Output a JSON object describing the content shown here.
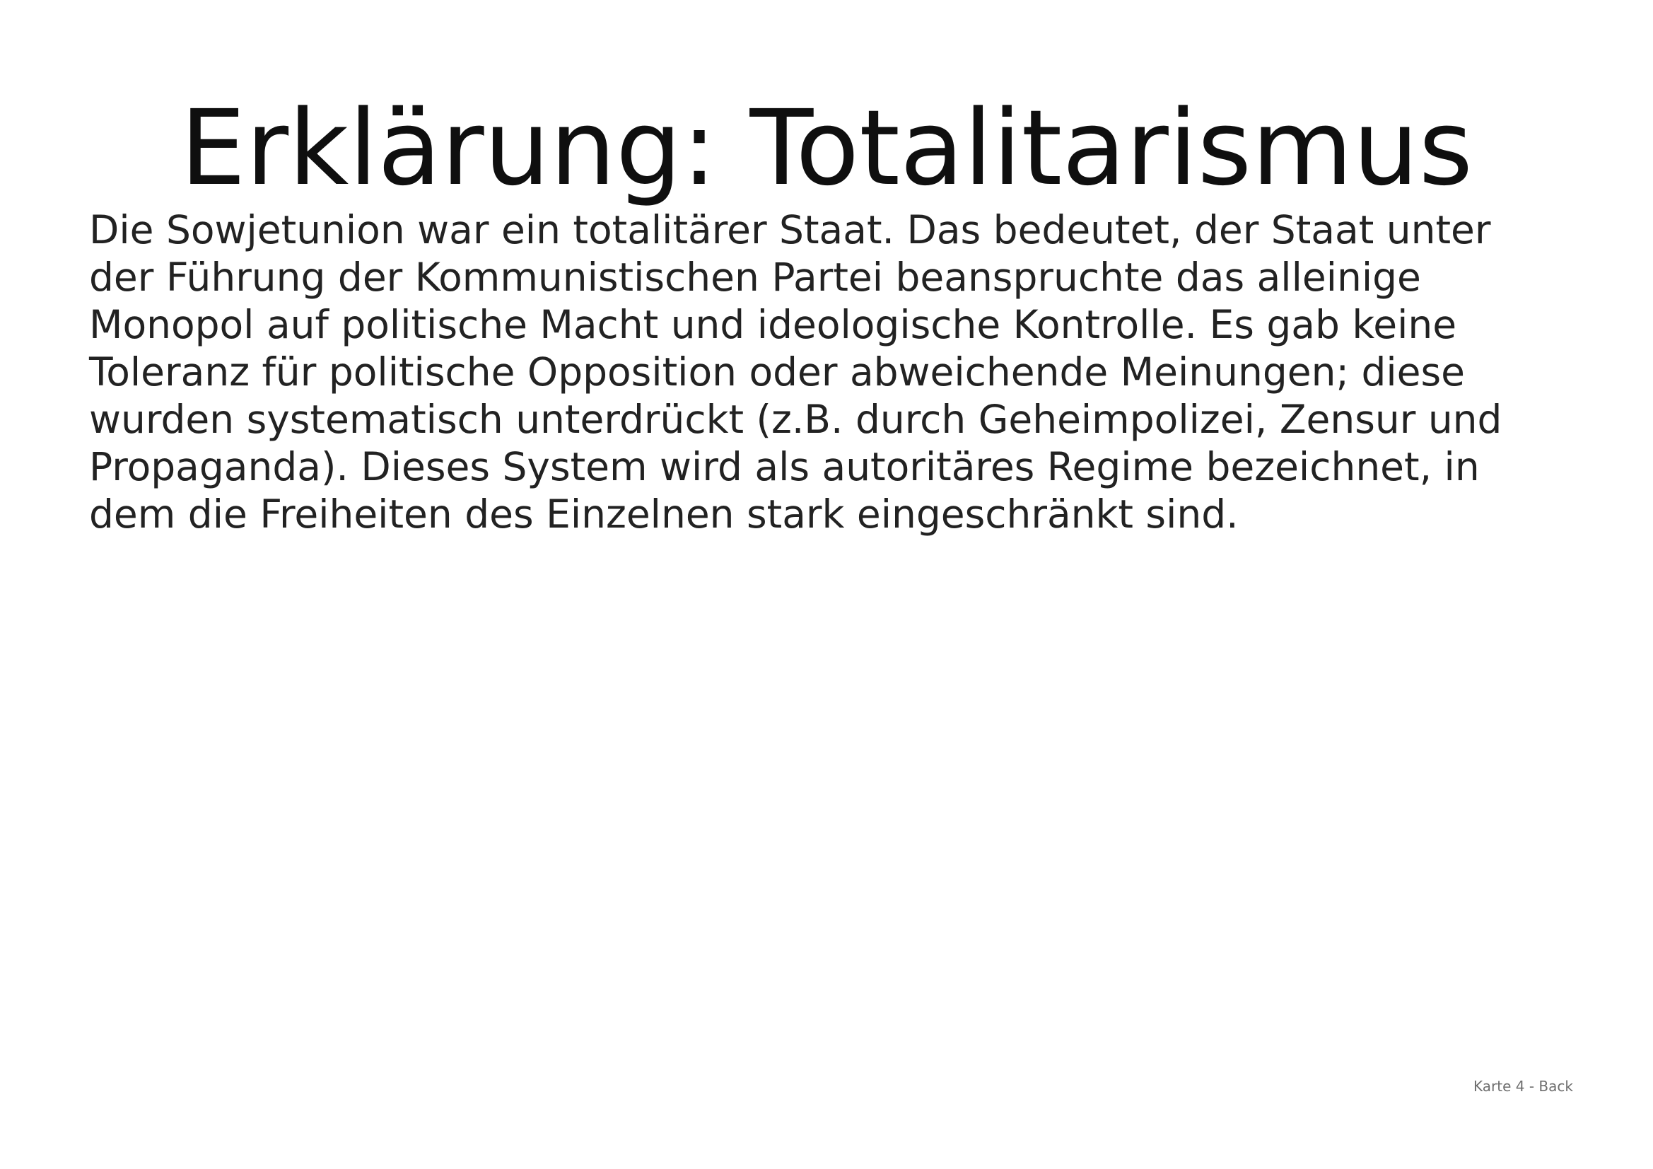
{
  "card": {
    "title": "Erklärung: Totalitarismus",
    "body_lines": [
      "Die Sowjetunion war ein totalitärer Staat. Das bedeutet, der Staat unter",
      "der Führung der Kommunistischen Partei beanspruchte das alleinige",
      "Monopol auf politische Macht und ideologische Kontrolle. Es gab keine",
      "Toleranz für politische Opposition oder abweichende Meinungen; diese",
      "wurden systematisch unterdrückt (z.B. durch Geheimpolizei, Zensur und",
      "Propaganda). Dieses System wird als autoritäres Regime bezeichnet, in",
      "dem die Freiheiten des Einzelnen stark eingeschränkt sind."
    ],
    "footer_label": "Karte 4 - Back"
  },
  "colors": {
    "background": "#ffffff",
    "title": "#0f0f0f",
    "body": "#222222",
    "footer": "#6e6e6e"
  }
}
